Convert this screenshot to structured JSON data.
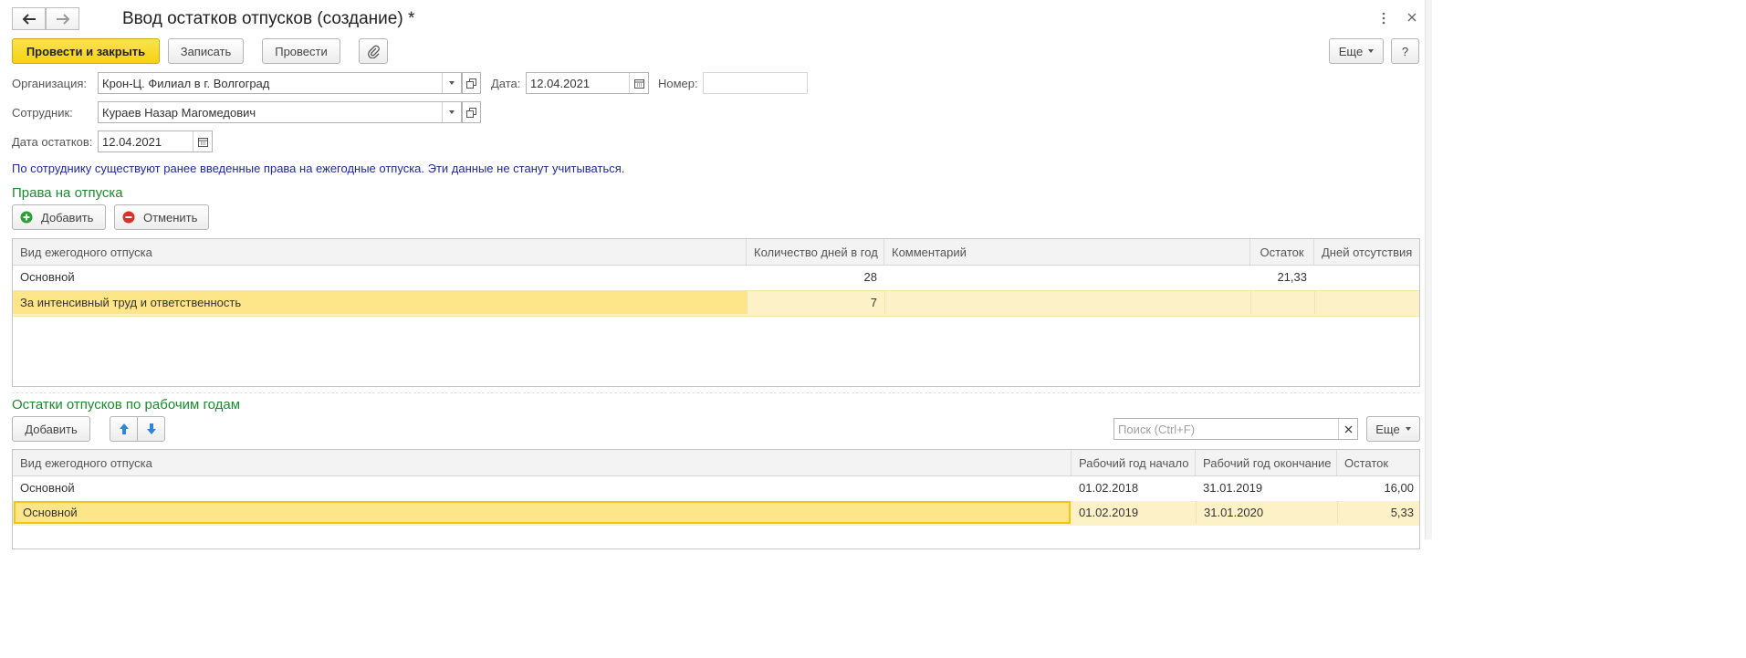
{
  "window": {
    "title": "Ввод остатков отпусков (создание) *"
  },
  "toolbar": {
    "post_close": "Провести и закрыть",
    "save": "Записать",
    "post": "Провести",
    "more": "Еще",
    "help": "?"
  },
  "form": {
    "org_label": "Организация:",
    "org_value": "Крон-Ц. Филиал в г. Волгоград",
    "date_label": "Дата:",
    "date_value": "12.04.2021",
    "number_label": "Номер:",
    "number_value": "",
    "employee_label": "Сотрудник:",
    "employee_value": "Кураев Назар Магомедович",
    "balance_date_label": "Дата остатков:",
    "balance_date_value": "12.04.2021",
    "info_message": "По сотруднику существуют ранее введенные права на ежегодные отпуска. Эти данные не станут учитываться."
  },
  "rights": {
    "title": "Права на отпуска",
    "add": "Добавить",
    "cancel": "Отменить",
    "columns": [
      "Вид ежегодного отпуска",
      "Количество дней в год",
      "Комментарий",
      "Остаток",
      "Дней отсутствия"
    ],
    "rows": [
      [
        "Основной",
        "28",
        "",
        "21,33",
        ""
      ],
      [
        "За интенсивный труд и ответственность",
        "7",
        "",
        "",
        ""
      ]
    ]
  },
  "balances": {
    "title": "Остатки отпусков по рабочим годам",
    "add": "Добавить",
    "search_placeholder": "Поиск (Ctrl+F)",
    "more": "Еще",
    "columns": [
      "Вид ежегодного отпуска",
      "Рабочий год начало",
      "Рабочий год окончание",
      "Остаток"
    ],
    "rows": [
      [
        "Основной",
        "01.02.2018",
        "31.01.2019",
        "16,00"
      ],
      [
        "Основной",
        "01.02.2019",
        "31.01.2020",
        "5,33"
      ]
    ]
  },
  "colors": {
    "primary": "#f5d20f",
    "section_title": "#1a8c2e",
    "info_text": "#1e2a9c",
    "selected_row": "#fdf2c7",
    "selected_cell": "#fde68a"
  }
}
